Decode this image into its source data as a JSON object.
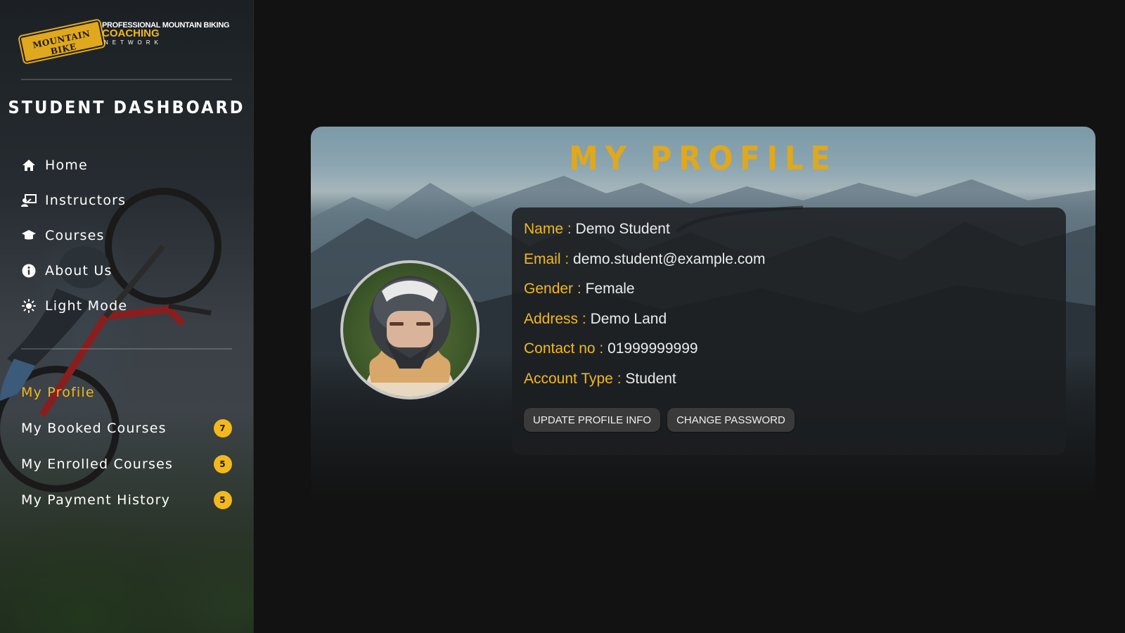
{
  "brand": {
    "badge_text": "MOUNTAIN BIKE",
    "line1": "PROFESSIONAL MOUNTAIN BIKING",
    "line2": "COACHING",
    "line3": "NETWORK"
  },
  "sidebar": {
    "title": "STUDENT DASHBOARD",
    "nav": [
      {
        "label": "Home",
        "icon": "home-icon"
      },
      {
        "label": "Instructors",
        "icon": "instructor-icon"
      },
      {
        "label": "Courses",
        "icon": "graduation-cap-icon"
      },
      {
        "label": "About Us",
        "icon": "info-icon"
      },
      {
        "label": "Light Mode",
        "icon": "sun-icon"
      }
    ],
    "sub_nav": [
      {
        "label": "My Profile",
        "active": true
      },
      {
        "label": "My Booked Courses",
        "badge": "7"
      },
      {
        "label": "My Enrolled Courses",
        "badge": "5"
      },
      {
        "label": "My Payment History",
        "badge": "5"
      }
    ]
  },
  "profile": {
    "title": "MY PROFILE",
    "fields": [
      {
        "label": "Name :",
        "value": "Demo Student"
      },
      {
        "label": "Email :",
        "value": "demo.student@example.com"
      },
      {
        "label": "Gender :",
        "value": "Female"
      },
      {
        "label": "Address :",
        "value": "Demo Land"
      },
      {
        "label": "Contact no :",
        "value": "01999999999"
      },
      {
        "label": "Account Type :",
        "value": "Student"
      }
    ],
    "buttons": {
      "update": "UPDATE PROFILE INFO",
      "change_password": "CHANGE PASSWORD"
    }
  },
  "colors": {
    "accent": "#f2b81c",
    "background": "#121212"
  }
}
